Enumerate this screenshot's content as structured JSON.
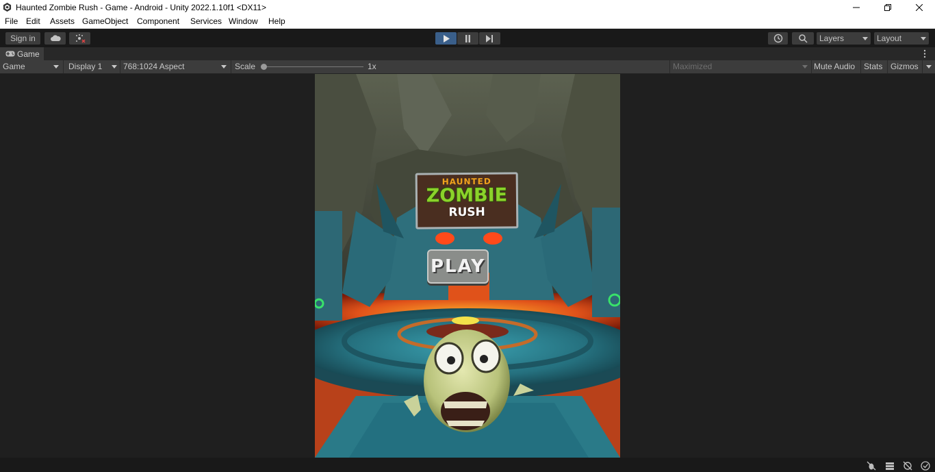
{
  "window": {
    "title": "Haunted Zombie Rush - Game - Android - Unity 2022.1.10f1 <DX11>"
  },
  "menu": [
    "File",
    "Edit",
    "Assets",
    "GameObject",
    "Component",
    "Services",
    "Window",
    "Help"
  ],
  "toolbar": {
    "sign_in": "Sign in",
    "layers": "Layers",
    "layout": "Layout"
  },
  "tab": {
    "label": "Game"
  },
  "game_toolbar": {
    "view": "Game",
    "display": "Display 1",
    "aspect": "768:1024 Aspect",
    "scale_label": "Scale",
    "scale_value": "1x",
    "play_mode": "Maximized",
    "mute": "Mute Audio",
    "stats": "Stats",
    "gizmos": "Gizmos"
  },
  "game": {
    "logo_line1": "HAUNTED",
    "logo_line2": "ZOMBIE",
    "logo_line3": "RUSH",
    "play_label": "PLAY"
  },
  "colors": {
    "play_active": "#3a5f8a",
    "logo_green": "#8bd22a",
    "logo_orange": "#f0a21c",
    "lava": "#e0521a"
  }
}
